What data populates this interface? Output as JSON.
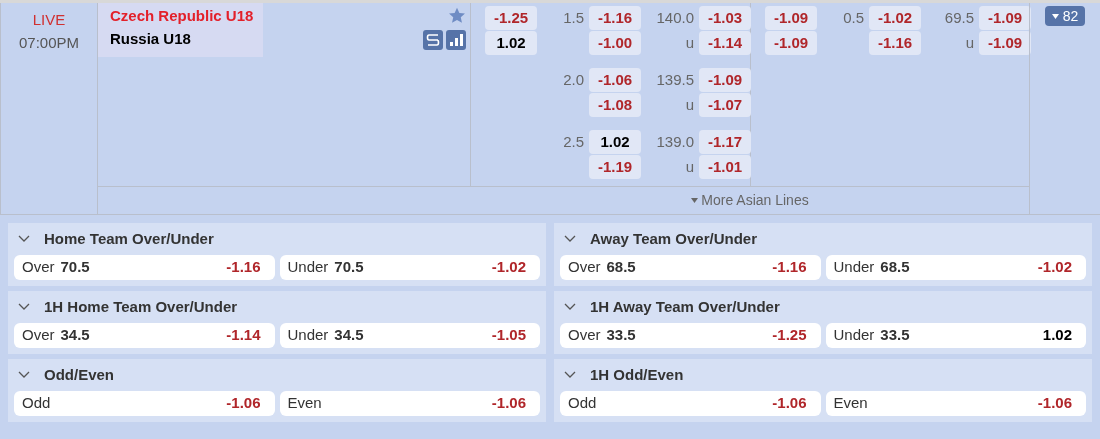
{
  "match": {
    "status": "LIVE",
    "time": "07:00PM",
    "home_team": "Czech Republic U18",
    "away_team": "Russia U18",
    "favorite": false
  },
  "full_time": {
    "moneyline": [
      {
        "value": "-1.25",
        "kind": "negative"
      },
      {
        "value": "1.02",
        "kind": "positive"
      }
    ],
    "lines": [
      {
        "handicap": "1.5",
        "home": {
          "value": "-1.16",
          "kind": "negative"
        },
        "away": {
          "value": "-1.00",
          "kind": "negative"
        },
        "total": "140.0",
        "over": {
          "value": "-1.03",
          "kind": "negative"
        },
        "under_label": "u",
        "under": {
          "value": "-1.14",
          "kind": "negative"
        }
      },
      {
        "handicap": "2.0",
        "home": {
          "value": "-1.06",
          "kind": "negative"
        },
        "away": {
          "value": "-1.08",
          "kind": "negative"
        },
        "total": "139.5",
        "over": {
          "value": "-1.09",
          "kind": "negative"
        },
        "under_label": "u",
        "under": {
          "value": "-1.07",
          "kind": "negative"
        }
      },
      {
        "handicap": "2.5",
        "home": {
          "value": "1.02",
          "kind": "positive"
        },
        "away": {
          "value": "-1.19",
          "kind": "negative"
        },
        "total": "139.0",
        "over": {
          "value": "-1.17",
          "kind": "negative"
        },
        "under_label": "u",
        "under": {
          "value": "-1.01",
          "kind": "negative"
        }
      }
    ]
  },
  "first_half": {
    "moneyline": [
      {
        "value": "-1.09",
        "kind": "negative"
      },
      {
        "value": "-1.09",
        "kind": "negative"
      }
    ],
    "lines": [
      {
        "handicap": "0.5",
        "home": {
          "value": "-1.02",
          "kind": "negative"
        },
        "away": {
          "value": "-1.16",
          "kind": "negative"
        },
        "total": "69.5",
        "over": {
          "value": "-1.09",
          "kind": "negative"
        },
        "under_label": "u",
        "under": {
          "value": "-1.09",
          "kind": "negative"
        }
      }
    ]
  },
  "more_markets": {
    "label": "82",
    "expanded": false
  },
  "more_lines": {
    "label": "More Asian Lines",
    "expanded": false
  },
  "markets": [
    {
      "title": "Home Team Over/Under",
      "expanded": true,
      "options": [
        {
          "label": "Over",
          "line": "70.5",
          "odds": {
            "value": "-1.16",
            "kind": "negative"
          }
        },
        {
          "label": "Under",
          "line": "70.5",
          "odds": {
            "value": "-1.02",
            "kind": "negative"
          }
        }
      ]
    },
    {
      "title": "Away Team Over/Under",
      "expanded": true,
      "options": [
        {
          "label": "Over",
          "line": "68.5",
          "odds": {
            "value": "-1.16",
            "kind": "negative"
          }
        },
        {
          "label": "Under",
          "line": "68.5",
          "odds": {
            "value": "-1.02",
            "kind": "negative"
          }
        }
      ]
    },
    {
      "title": "1H Home Team Over/Under",
      "expanded": true,
      "options": [
        {
          "label": "Over",
          "line": "34.5",
          "odds": {
            "value": "-1.14",
            "kind": "negative"
          }
        },
        {
          "label": "Under",
          "line": "34.5",
          "odds": {
            "value": "-1.05",
            "kind": "negative"
          }
        }
      ]
    },
    {
      "title": "1H Away Team Over/Under",
      "expanded": true,
      "options": [
        {
          "label": "Over",
          "line": "33.5",
          "odds": {
            "value": "-1.25",
            "kind": "negative"
          }
        },
        {
          "label": "Under",
          "line": "33.5",
          "odds": {
            "value": "1.02",
            "kind": "positive"
          }
        }
      ]
    },
    {
      "title": "Odd/Even",
      "expanded": true,
      "options": [
        {
          "label": "Odd",
          "odds": {
            "value": "-1.06",
            "kind": "negative"
          }
        },
        {
          "label": "Even",
          "odds": {
            "value": "-1.06",
            "kind": "negative"
          }
        }
      ]
    },
    {
      "title": "1H Odd/Even",
      "expanded": true,
      "options": [
        {
          "label": "Odd",
          "odds": {
            "value": "-1.06",
            "kind": "negative"
          }
        },
        {
          "label": "Even",
          "odds": {
            "value": "-1.06",
            "kind": "negative"
          }
        }
      ]
    }
  ]
}
